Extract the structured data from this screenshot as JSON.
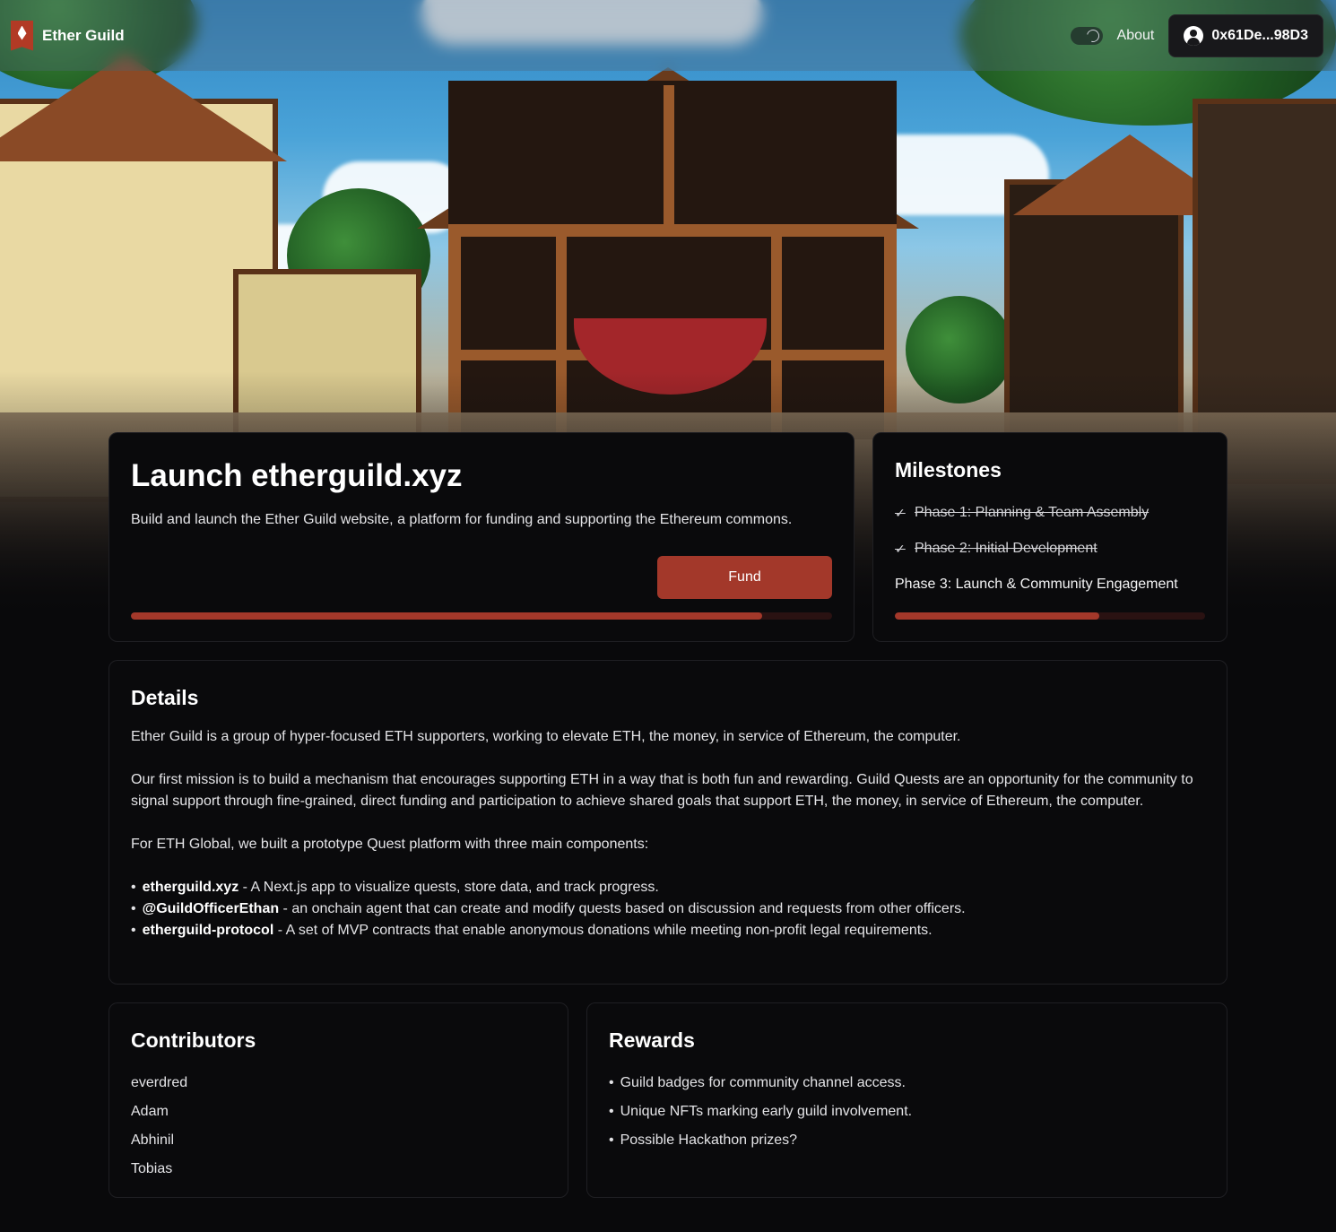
{
  "brand": {
    "name": "Ether Guild"
  },
  "nav": {
    "about": "About",
    "wallet_address": "0x61De...98D3"
  },
  "quest": {
    "title": "Launch etherguild.xyz",
    "description": "Build and launch the Ether Guild website, a platform for funding and supporting the Ethereum commons.",
    "fund_label": "Fund",
    "progress": 0.9
  },
  "milestones": {
    "heading": "Milestones",
    "items": [
      {
        "label": "Phase 1: Planning & Team Assembly",
        "done": true
      },
      {
        "label": "Phase 2: Initial Development",
        "done": true
      },
      {
        "label": "Phase 3: Launch & Community Engagement",
        "done": false
      }
    ],
    "progress": 0.66
  },
  "details": {
    "heading": "Details",
    "p1": "Ether Guild is a group of hyper-focused ETH supporters, working to elevate ETH, the money, in service of Ethereum, the computer.",
    "p2": "Our first mission is to build a mechanism that encourages supporting ETH in a way that is both fun and rewarding. Guild Quests are an opportunity for the community to signal support through fine-grained, direct funding and participation to achieve shared goals that support ETH, the money, in service of Ethereum, the computer.",
    "p3": "For ETH Global, we built a prototype Quest platform with three main components:",
    "components": [
      {
        "name": "etherguild.xyz",
        "text": " - A Next.js app to visualize quests, store data, and track progress."
      },
      {
        "name": "@GuildOfficerEthan",
        "text": " - an onchain agent that can create and modify quests based on discussion and requests from other officers."
      },
      {
        "name": "etherguild-protocol",
        "text": " - A set of MVP contracts that enable anonymous donations while meeting non-profit legal requirements."
      }
    ]
  },
  "contributors": {
    "heading": "Contributors",
    "names": [
      "everdred",
      "Adam",
      "Abhinil",
      "Tobias"
    ]
  },
  "rewards": {
    "heading": "Rewards",
    "items": [
      "Guild badges for community channel access.",
      "Unique NFTs marking early guild involvement.",
      "Possible Hackathon prizes?"
    ]
  },
  "colors": {
    "accent": "#a3382a",
    "background": "#09090b",
    "card": "#0a0a0c",
    "border": "#1f1f23"
  }
}
